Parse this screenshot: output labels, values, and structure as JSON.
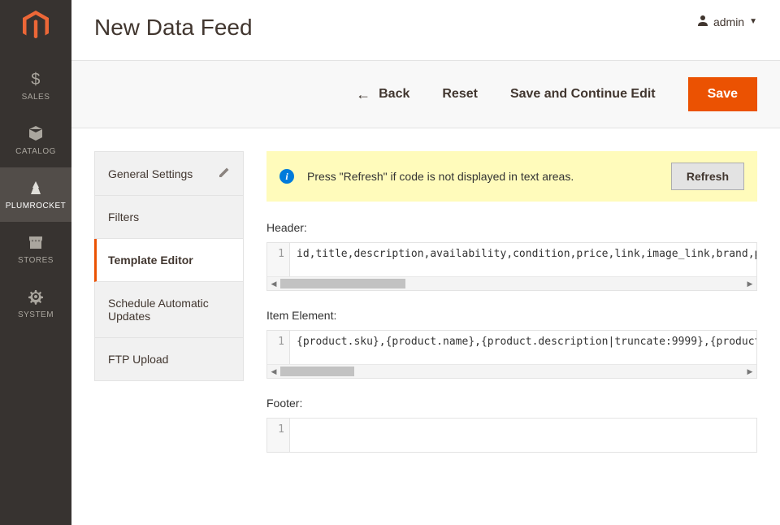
{
  "user": {
    "name": "admin"
  },
  "page": {
    "title": "New Data Feed"
  },
  "actions": {
    "back": "Back",
    "reset": "Reset",
    "save_continue": "Save and Continue Edit",
    "save": "Save"
  },
  "sidebar": {
    "items": [
      {
        "id": "sales",
        "label": "SALES"
      },
      {
        "id": "catalog",
        "label": "CATALOG"
      },
      {
        "id": "plumrocket",
        "label": "PLUMROCKET"
      },
      {
        "id": "stores",
        "label": "STORES"
      },
      {
        "id": "system",
        "label": "SYSTEM"
      }
    ]
  },
  "tabs": [
    {
      "id": "general",
      "label": "General Settings",
      "editable": true
    },
    {
      "id": "filters",
      "label": "Filters"
    },
    {
      "id": "template",
      "label": "Template Editor",
      "active": true
    },
    {
      "id": "schedule",
      "label": "Schedule Automatic Updates"
    },
    {
      "id": "ftp",
      "label": "FTP Upload"
    }
  ],
  "alert": {
    "text": "Press \"Refresh\" if code is not displayed in text areas.",
    "button": "Refresh"
  },
  "editor": {
    "header_label": "Header:",
    "header_code": "id,title,description,availability,condition,price,link,image_link,brand,p",
    "item_label": "Item Element:",
    "item_code": "{product.sku},{product.name},{product.description|truncate:9999},{product",
    "footer_label": "Footer:",
    "footer_code": ""
  }
}
